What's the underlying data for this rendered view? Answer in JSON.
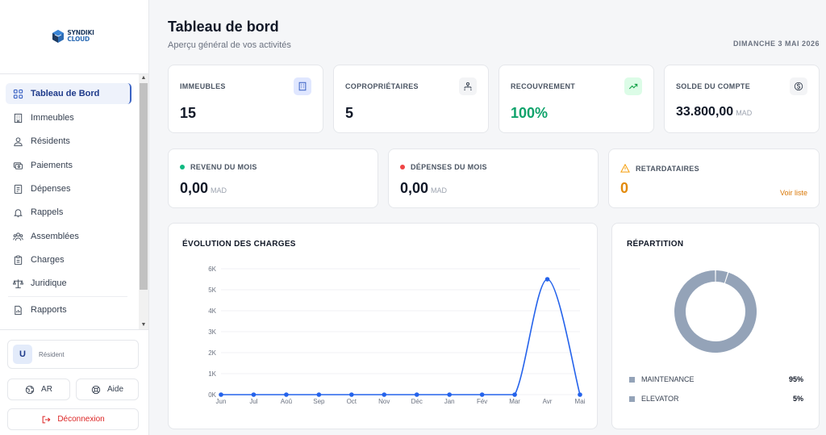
{
  "brand": {
    "line1": "SYNDIKI",
    "line2": "CLOUD"
  },
  "sidebar": {
    "items": [
      {
        "label": "Tableau de Bord",
        "icon": "grid-icon"
      },
      {
        "label": "Immeubles",
        "icon": "building-icon"
      },
      {
        "label": "Résidents",
        "icon": "users-icon"
      },
      {
        "label": "Paiements",
        "icon": "payments-icon"
      },
      {
        "label": "Dépenses",
        "icon": "receipt-icon"
      },
      {
        "label": "Rappels",
        "icon": "bell-icon"
      },
      {
        "label": "Assemblées",
        "icon": "group-icon"
      },
      {
        "label": "Charges",
        "icon": "clipboard-icon"
      },
      {
        "label": "Juridique",
        "icon": "scale-icon"
      },
      {
        "label": "Rapports",
        "icon": "report-icon"
      }
    ],
    "user": {
      "initial": "U",
      "role": "Résident"
    },
    "lang_button": "AR",
    "help_button": "Aide",
    "logout_button": "Déconnexion"
  },
  "header": {
    "title": "Tableau de bord",
    "subtitle": "Aperçu général de vos activités",
    "date": "DIMANCHE 3 MAI 2026"
  },
  "stats": [
    {
      "label": "IMMEUBLES",
      "value": "15",
      "unit": "",
      "icon": "building-icon",
      "accent": "#e0e7ff"
    },
    {
      "label": "COPROPRIÉTAIRES",
      "value": "5",
      "unit": "",
      "icon": "org-icon",
      "accent": "#f3f4f6"
    },
    {
      "label": "RECOUVREMENT",
      "value": "100%",
      "unit": "",
      "icon": "trend-up-icon",
      "accent": "#dcfce7"
    },
    {
      "label": "SOLDE DU COMPTE",
      "value": "33.800,00",
      "unit": "MAD",
      "icon": "dollar-icon",
      "accent": "#f3f4f6"
    }
  ],
  "monthly": {
    "revenue": {
      "label": "REVENU DU MOIS",
      "value": "0,00",
      "unit": "MAD",
      "color": "#10b981"
    },
    "expenses": {
      "label": "DÉPENSES DU MOIS",
      "value": "0,00",
      "unit": "MAD",
      "color": "#ef4444"
    },
    "late": {
      "label": "RETARDATAIRES",
      "value": "0",
      "link": "Voir liste",
      "color": "#f59e0b"
    }
  },
  "chart_data": [
    {
      "type": "line",
      "title": "ÉVOLUTION DES CHARGES",
      "categories": [
        "Jun",
        "Jul",
        "Aoû",
        "Sep",
        "Oct",
        "Nov",
        "Déc",
        "Jan",
        "Fév",
        "Mar",
        "Avr",
        "Mai"
      ],
      "series": [
        {
          "values": [
            0,
            0,
            0,
            0,
            0,
            0,
            0,
            0,
            0,
            0,
            5500,
            0
          ],
          "color": "#2563eb"
        }
      ],
      "yticks": [
        "0K",
        "1K",
        "2K",
        "3K",
        "4K",
        "5K",
        "6K"
      ],
      "ylim": [
        0,
        6000
      ],
      "grid": true
    },
    {
      "type": "pie",
      "title": "RÉPARTITION",
      "slices": [
        {
          "name": "MAINTENANCE",
          "pct_label": "95%",
          "value": 95,
          "color": "#94a3b8"
        },
        {
          "name": "ELEVATOR",
          "pct_label": "5%",
          "value": 5,
          "color": "#94a3b8"
        }
      ]
    }
  ]
}
